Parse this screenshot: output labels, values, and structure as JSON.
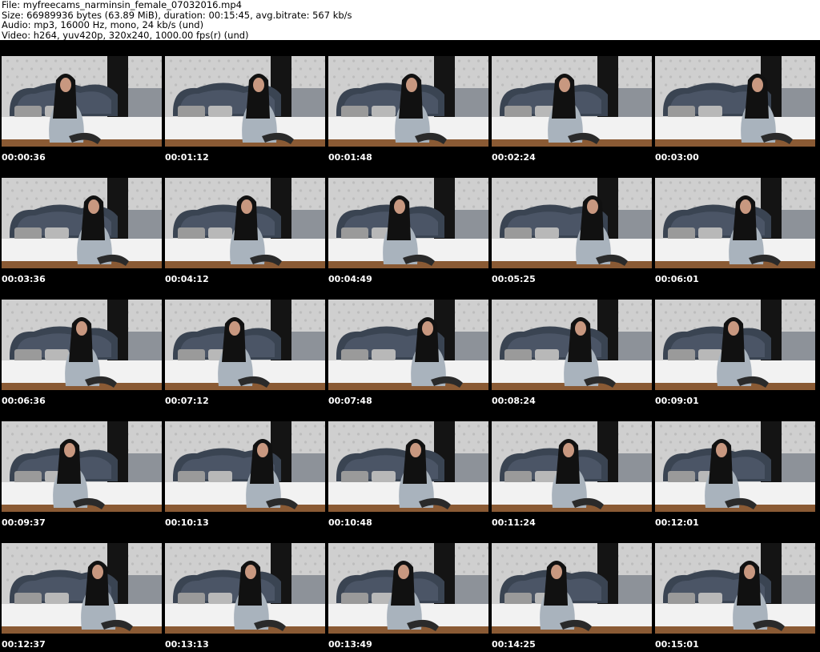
{
  "header": {
    "file_line": "File: myfreecams_narminsin_female_07032016.mp4",
    "size_line": "Size: 66989936 bytes (63.89 MiB), duration: 00:15:45, avg.bitrate: 567 kb/s",
    "audio_line": "Audio: mp3, 16000 Hz, mono, 24 kb/s (und)",
    "video_line": "Video: h264, yuv420p, 320x240, 1000.00 fps(r) (und)"
  },
  "thumbnails": [
    {
      "timestamp": "00:00:36"
    },
    {
      "timestamp": "00:01:12"
    },
    {
      "timestamp": "00:01:48"
    },
    {
      "timestamp": "00:02:24"
    },
    {
      "timestamp": "00:03:00"
    },
    {
      "timestamp": "00:03:36"
    },
    {
      "timestamp": "00:04:12"
    },
    {
      "timestamp": "00:04:49"
    },
    {
      "timestamp": "00:05:25"
    },
    {
      "timestamp": "00:06:01"
    },
    {
      "timestamp": "00:06:36"
    },
    {
      "timestamp": "00:07:12"
    },
    {
      "timestamp": "00:07:48"
    },
    {
      "timestamp": "00:08:24"
    },
    {
      "timestamp": "00:09:01"
    },
    {
      "timestamp": "00:09:37"
    },
    {
      "timestamp": "00:10:13"
    },
    {
      "timestamp": "00:10:48"
    },
    {
      "timestamp": "00:11:24"
    },
    {
      "timestamp": "00:12:01"
    },
    {
      "timestamp": "00:12:37"
    },
    {
      "timestamp": "00:13:13"
    },
    {
      "timestamp": "00:13:49"
    },
    {
      "timestamp": "00:14:25"
    },
    {
      "timestamp": "00:15:01"
    }
  ],
  "colors": {
    "wallpaper": "#cfcfcf",
    "headboard": "#3a4452",
    "curtain": "#141414",
    "bed": "#f2f2f2",
    "dress": "#a9b3bd",
    "hair": "#111111",
    "skin": "#c89880",
    "floor": "#8a5a34"
  }
}
